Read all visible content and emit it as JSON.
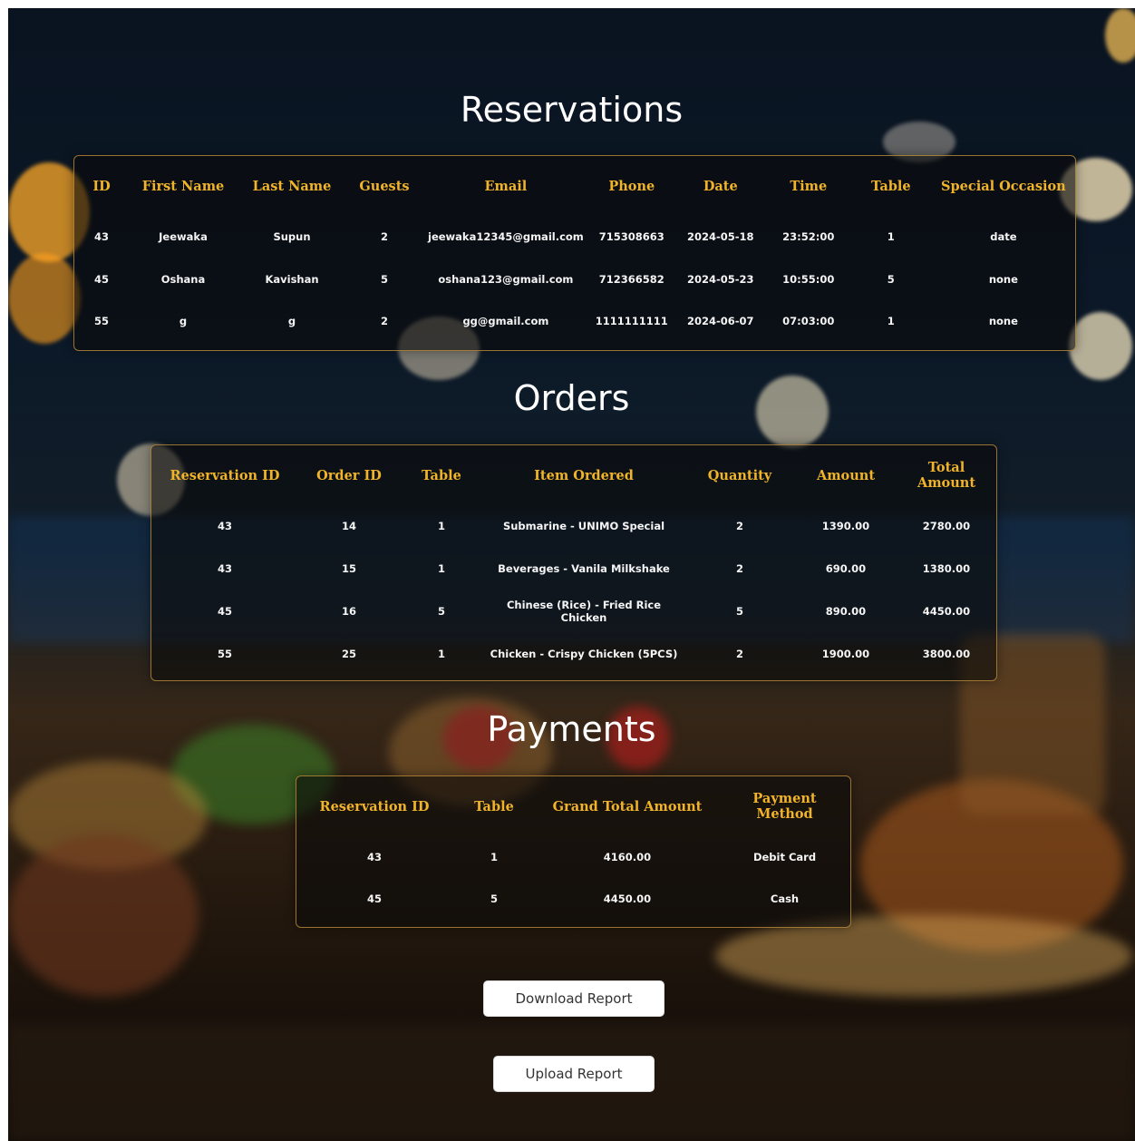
{
  "reservations": {
    "title": "Reservations",
    "columns": [
      "ID",
      "First Name",
      "Last Name",
      "Guests",
      "Email",
      "Phone",
      "Date",
      "Time",
      "Table",
      "Special Occasion"
    ],
    "rows": [
      [
        "43",
        "Jeewaka",
        "Supun",
        "2",
        "jeewaka12345@gmail.com",
        "715308663",
        "2024-05-18",
        "23:52:00",
        "1",
        "date"
      ],
      [
        "45",
        "Oshana",
        "Kavishan",
        "5",
        "oshana123@gmail.com",
        "712366582",
        "2024-05-23",
        "10:55:00",
        "5",
        "none"
      ],
      [
        "55",
        "g",
        "g",
        "2",
        "gg@gmail.com",
        "1111111111",
        "2024-06-07",
        "07:03:00",
        "1",
        "none"
      ]
    ]
  },
  "orders": {
    "title": "Orders",
    "columns": [
      "Reservation ID",
      "Order ID",
      "Table",
      "Item Ordered",
      "Quantity",
      "Amount",
      "Total Amount"
    ],
    "rows": [
      [
        "43",
        "14",
        "1",
        "Submarine - UNIMO Special",
        "2",
        "1390.00",
        "2780.00"
      ],
      [
        "43",
        "15",
        "1",
        "Beverages - Vanila Milkshake",
        "2",
        "690.00",
        "1380.00"
      ],
      [
        "45",
        "16",
        "5",
        "Chinese (Rice) - Fried Rice Chicken",
        "5",
        "890.00",
        "4450.00"
      ],
      [
        "55",
        "25",
        "1",
        "Chicken - Crispy Chicken (5PCS)",
        "2",
        "1900.00",
        "3800.00"
      ]
    ]
  },
  "payments": {
    "title": "Payments",
    "columns": [
      "Reservation ID",
      "Table",
      "Grand Total Amount",
      "Payment Method"
    ],
    "rows": [
      [
        "43",
        "1",
        "4160.00",
        "Debit Card"
      ],
      [
        "45",
        "5",
        "4450.00",
        "Cash"
      ]
    ]
  },
  "buttons": {
    "download": "Download Report",
    "upload": "Upload Report"
  },
  "colors": {
    "header_text": "#f0b32a",
    "panel_border": "#c8963c",
    "cell_text": "#f5f5f5"
  }
}
